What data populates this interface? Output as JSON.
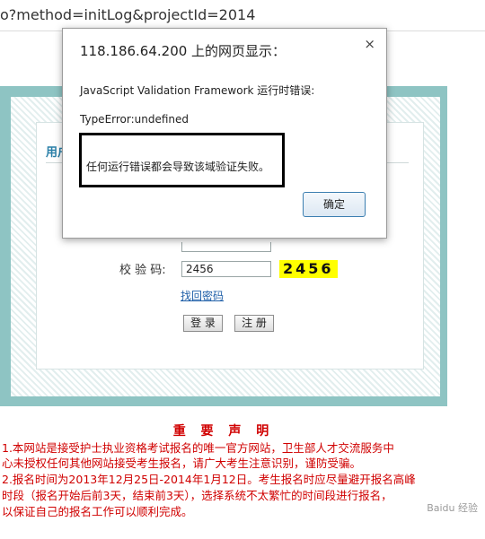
{
  "browser": {
    "url": "o?method=initLog&projectId=2014"
  },
  "login": {
    "tab_title": "用户",
    "captcha_label": "校 验 码:",
    "captcha_value": "2456",
    "captcha_image_text": "2456",
    "forgot_link": "找回密码",
    "login_button": "登 录",
    "register_button": "注 册"
  },
  "notice": {
    "title": "重 要 声 明",
    "lines": [
      "1.本网站是接受护士执业资格考试报名的唯一官方网站，卫生部人才交流服务中",
      "心未授权任何其他网站接受考生报名，请广大考生注意识别，谨防受骗。",
      "2.报名时间为2013年12月25日-2014年1月12日。考生报名时应尽量避开报名高峰",
      "时段（报名开始后前3天，结束前3天），选择系统不太繁忙的时间段进行报名，",
      "以保证自己的报名工作可以顺利完成。"
    ]
  },
  "dialog": {
    "title": "118.186.64.200 上的网页显示：",
    "close_symbol": "×",
    "message_1": "JavaScript Validation Framework 运行时错误:",
    "message_2": "TypeError:undefined",
    "message_3": "任何运行错误都会导致该域验证失败。",
    "ok_button": "确定"
  },
  "watermark": "Baidu 经验",
  "colors": {
    "frame": "#8ec4c3",
    "notice_red": "#d00000",
    "captcha_bg": "#ffff00",
    "link_blue": "#1f5fa8"
  }
}
